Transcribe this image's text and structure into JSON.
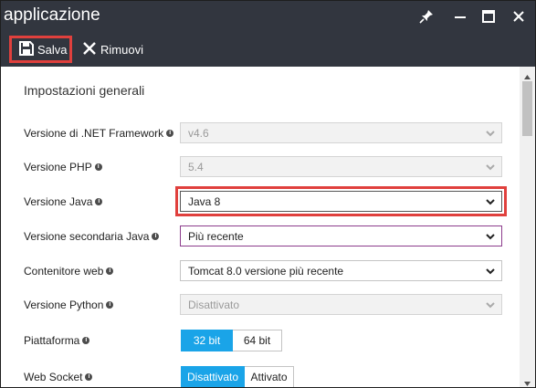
{
  "window": {
    "title": "applicazione"
  },
  "toolbar": {
    "save_label": "Salva",
    "remove_label": "Rimuovi"
  },
  "section": {
    "title": "Impostazioni generali"
  },
  "settings": [
    {
      "label": "Versione di .NET Framework",
      "value": "v4.6",
      "disabled": true
    },
    {
      "label": "Versione PHP",
      "value": "5.4",
      "disabled": true
    },
    {
      "label": "Versione Java",
      "value": "Java 8",
      "disabled": false
    },
    {
      "label": "Versione secondaria Java",
      "value": "Più recente",
      "disabled": false
    },
    {
      "label": "Contenitore web",
      "value": "Tomcat 8.0 versione più recente",
      "disabled": false
    },
    {
      "label": "Versione Python",
      "value": "Disattivato",
      "disabled": true
    }
  ],
  "platform": {
    "label": "Piattaforma",
    "options": [
      "32 bit",
      "64 bit"
    ],
    "selected": "32 bit"
  },
  "websocket": {
    "label": "Web Socket",
    "options": [
      "Disattivato",
      "Attivato"
    ],
    "selected": "Disattivato"
  },
  "icons": {
    "info": "info-icon",
    "chevron": "chevron-down-icon",
    "save": "floppy-disk-icon",
    "remove": "x-icon",
    "pin": "pin-icon",
    "minimize": "minimize-icon",
    "maximize": "maximize-icon",
    "close": "close-icon"
  },
  "colors": {
    "titlebar": "#32363f",
    "highlight": "#e0403d",
    "toggle_on": "#1aa4e8",
    "accent_purple": "#8c3c8c"
  }
}
